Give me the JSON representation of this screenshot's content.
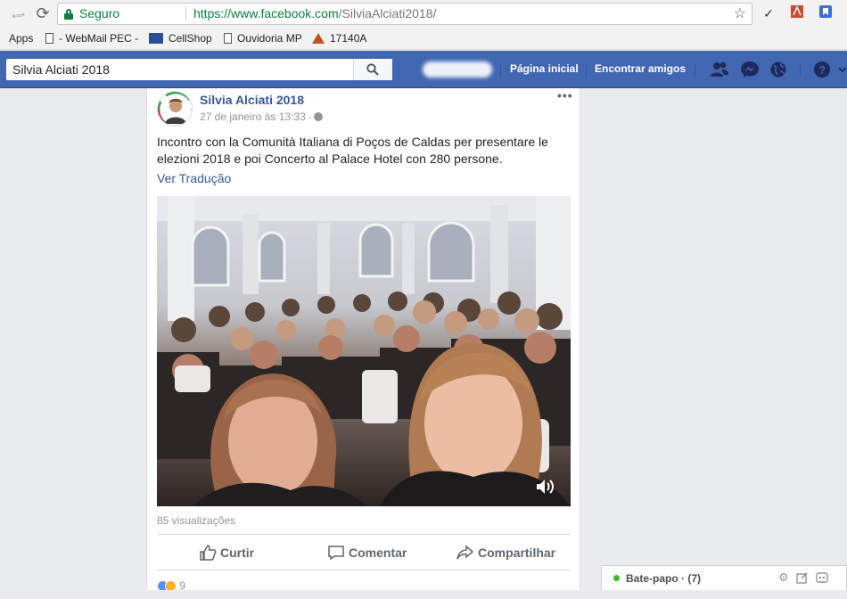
{
  "browser": {
    "secure_label": "Seguro",
    "url_host": "https://www.facebook.com",
    "url_path": "/SilviaAlciati2018/",
    "bookmarks": [
      {
        "label": "Apps"
      },
      {
        "label": "- WebMail PEC -"
      },
      {
        "label": "CellShop"
      },
      {
        "label": "Ouvidoria MP"
      },
      {
        "label": "17140A"
      }
    ]
  },
  "fb_header": {
    "search_value": "Silvia Alciati 2018",
    "home_label": "Página inicial",
    "find_friends_label": "Encontrar amigos"
  },
  "post": {
    "author": "Silvia Alciati 2018",
    "timestamp": "27 de janeiro às 13:33 ·",
    "text": "Incontro con la Comunità Italiana di Poços de Caldas per presentare le elezioni 2018 e poi Concerto al Palace Hotel con 280 persone.",
    "translate_label": "Ver Tradução",
    "views": "85 visualizações",
    "actions": {
      "like": "Curtir",
      "comment": "Comentar",
      "share": "Compartilhar"
    },
    "reaction_count": "9"
  },
  "chat": {
    "label": "Bate-papo · (7)"
  },
  "colors": {
    "fb_blue": "#4267b2",
    "link_blue": "#365899",
    "secure_green": "#0b8043",
    "page_bg": "#e9ebee"
  },
  "icons": [
    "back-arrow-icon",
    "forward-arrow-icon",
    "reload-icon",
    "lock-icon",
    "star-icon",
    "search-icon",
    "friends-icon",
    "messenger-icon",
    "globe-icon",
    "help-icon",
    "more-icon",
    "volume-icon",
    "like-icon",
    "comment-icon",
    "share-icon",
    "settings-icon",
    "compose-icon",
    "chat-options-icon"
  ]
}
